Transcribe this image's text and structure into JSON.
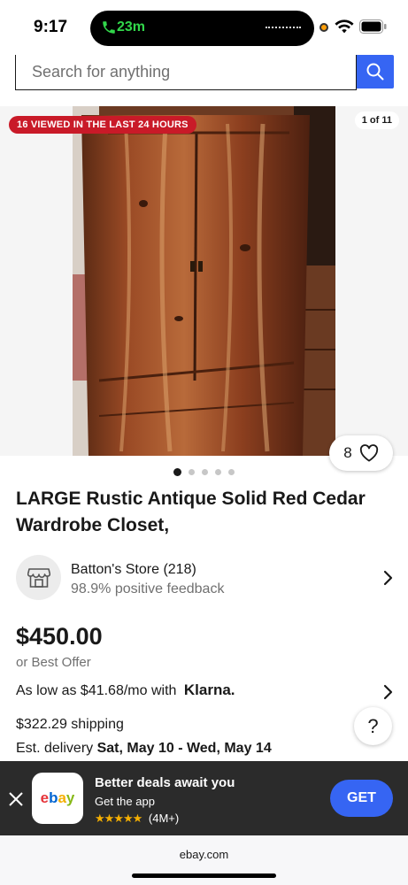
{
  "status_bar": {
    "time": "9:17",
    "call_duration": "23m"
  },
  "search": {
    "placeholder": "Search for anything"
  },
  "gallery": {
    "viewed_badge": "16 VIEWED IN THE LAST 24 HOURS",
    "counter": "1 of 11",
    "watch_count": "8",
    "total_dots": 5,
    "active_dot": 0
  },
  "listing": {
    "title": "LARGE Rustic Antique Solid Red Cedar Wardrobe Closet,",
    "seller_name": "Batton's Store (218)",
    "seller_feedback": "98.9% positive feedback",
    "price": "$450.00",
    "best_offer": "or Best Offer",
    "klarna_text": "As low as $41.68/mo with",
    "klarna_brand": "Klarna.",
    "shipping": "$322.29 shipping",
    "delivery_prefix": "Est. delivery",
    "delivery_dates": "Sat, May 10 - Wed, May 14",
    "help_label": "?"
  },
  "app_banner": {
    "app_name": "ebay",
    "title": "Better deals await you",
    "subtitle": "Get the app",
    "stars": "★★★★★",
    "rating_count": "(4M+)",
    "get_label": "GET"
  },
  "browser": {
    "url": "ebay.com"
  },
  "colors": {
    "accent_blue": "#3665f3",
    "badge_red": "#c91a28",
    "banner_dark": "#2b2b2b"
  }
}
